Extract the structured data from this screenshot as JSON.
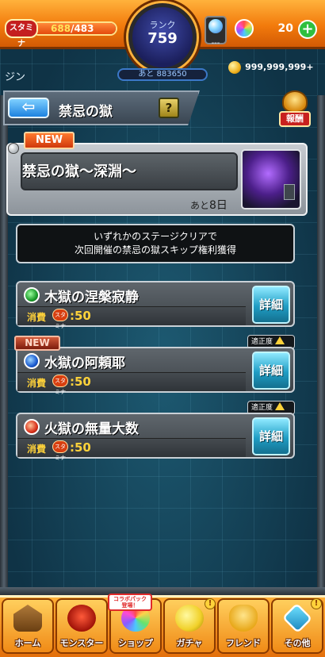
{
  "header": {
    "stamina_label": "スタミナ",
    "stamina_current": "688",
    "stamina_max": "/483",
    "rank_label": "ランク",
    "rank_value": "759",
    "exp_to_next": "あと 883650",
    "orb_box_value": "---",
    "orb_count": "20",
    "plus_symbol": "+",
    "player_name": "ジン",
    "coins": "999,999,999+"
  },
  "nav_bar": {
    "back_symbol": "⇦",
    "title": "禁忌の獄",
    "help_symbol": "?",
    "reward_label": "報酬"
  },
  "event": {
    "badge": "NEW",
    "title": "禁忌の獄～深淵～",
    "remaining_prefix": "あと",
    "remaining_days": "8日"
  },
  "notice": {
    "line1": "いずれかのステージクリアで",
    "line2": "次回開催の禁忌の獄スキップ権利獲得"
  },
  "stages": [
    {
      "name": "木獄の涅槃寂静",
      "cost_label": "消費",
      "stamina_icon": "スタミナ",
      "cost": ":50",
      "detail": "詳細",
      "element": "wood"
    },
    {
      "name": "水獄の阿頼耶",
      "cost_label": "消費",
      "stamina_icon": "スタミナ",
      "cost": ":50",
      "detail": "詳細",
      "element": "water",
      "badge": "NEW",
      "aptitude": "適正度"
    },
    {
      "name": "火獄の無量大数",
      "cost_label": "消費",
      "stamina_icon": "スタミナ",
      "cost": ":50",
      "detail": "詳細",
      "element": "fire",
      "aptitude": "適正度"
    }
  ],
  "bottom_nav": {
    "collab_tag_line1": "コラボパック",
    "collab_tag_line2": "登場！",
    "items": [
      {
        "label": "ホーム",
        "icon": "home-icon"
      },
      {
        "label": "モンスター",
        "icon": "monster-icon"
      },
      {
        "label": "ショップ",
        "icon": "shop-icon"
      },
      {
        "label": "ガチャ",
        "icon": "gacha-icon"
      },
      {
        "label": "フレンド",
        "icon": "friend-icon"
      },
      {
        "label": "その他",
        "icon": "other-icon"
      }
    ],
    "alert_symbol": "!"
  }
}
